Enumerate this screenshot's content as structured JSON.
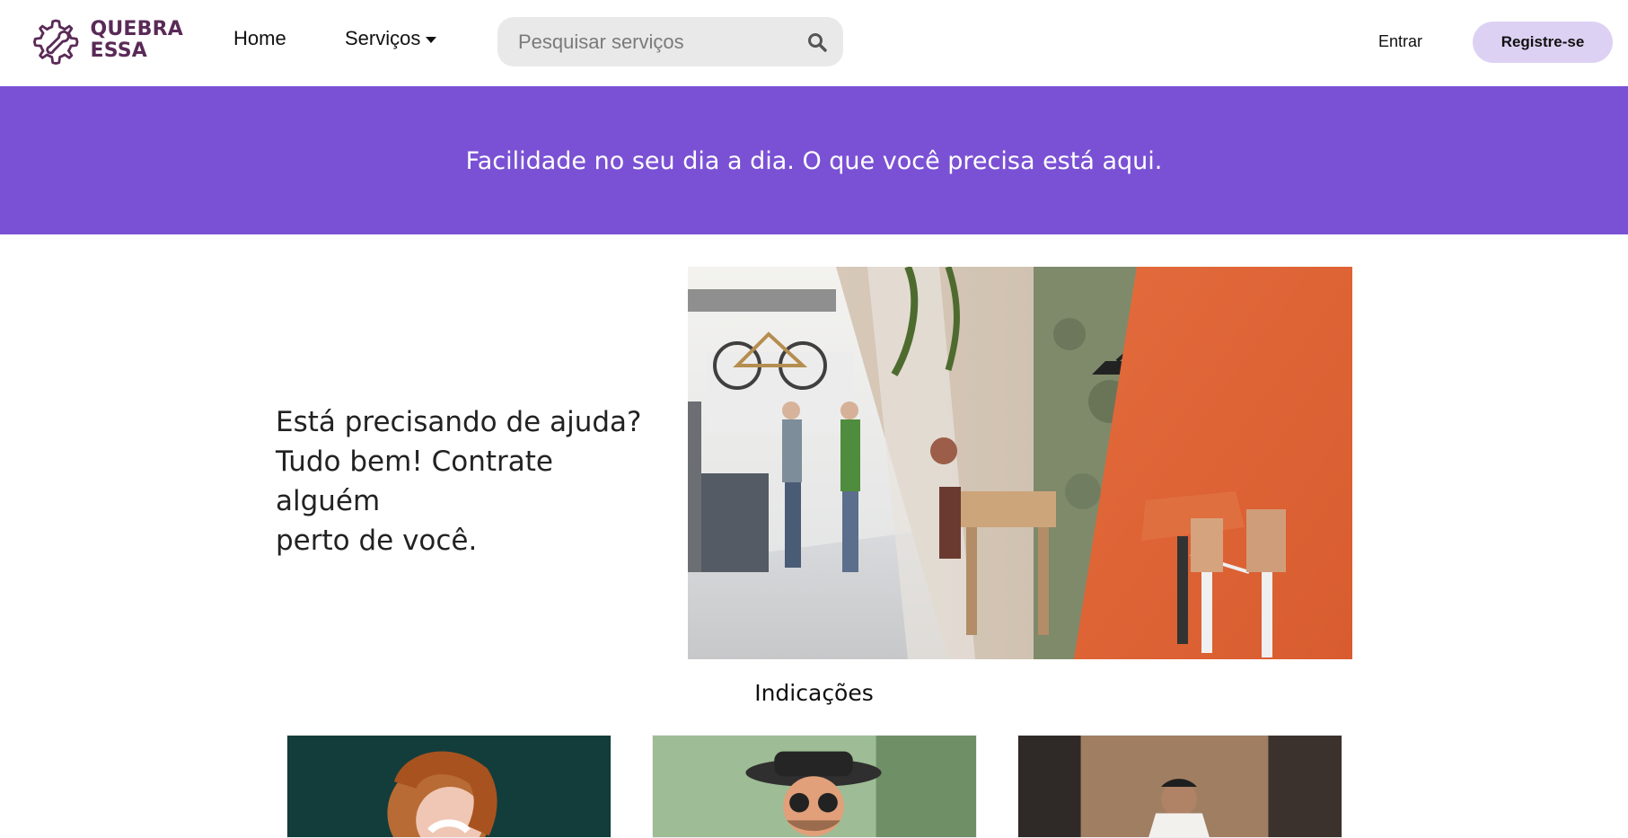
{
  "header": {
    "brand": {
      "line1": "QUEBRA",
      "line2": "ESSA",
      "logo_icon": "gear-wrench-icon"
    },
    "nav": {
      "home_label": "Home",
      "services_label": "Serviços",
      "services_icon": "caret-down-icon"
    },
    "search": {
      "placeholder": "Pesquisar serviços",
      "value": "",
      "icon": "search-icon"
    },
    "actions": {
      "login_label": "Entrar",
      "register_label": "Registre-se"
    }
  },
  "hero": {
    "tagline": "Facilidade no seu dia a dia. O que você precisa está aqui."
  },
  "main": {
    "line1": "Está precisando de ajuda?",
    "line2": "Tudo bem! Contrate alguém",
    "line3": "perto de você.",
    "collage_image": "home-services-collage"
  },
  "recommendations": {
    "title": "Indicações",
    "cards": [
      {
        "image": "smiling-woman-red-hair-photo"
      },
      {
        "image": "man-hat-sunglasses-photo"
      },
      {
        "image": "man-white-shirt-doorway-photo"
      }
    ]
  },
  "colors": {
    "hero_bg": "#7a51d4",
    "register_bg": "#ddd1f3",
    "search_bg": "#e9e9e9",
    "brand_text": "#5a2a57"
  }
}
